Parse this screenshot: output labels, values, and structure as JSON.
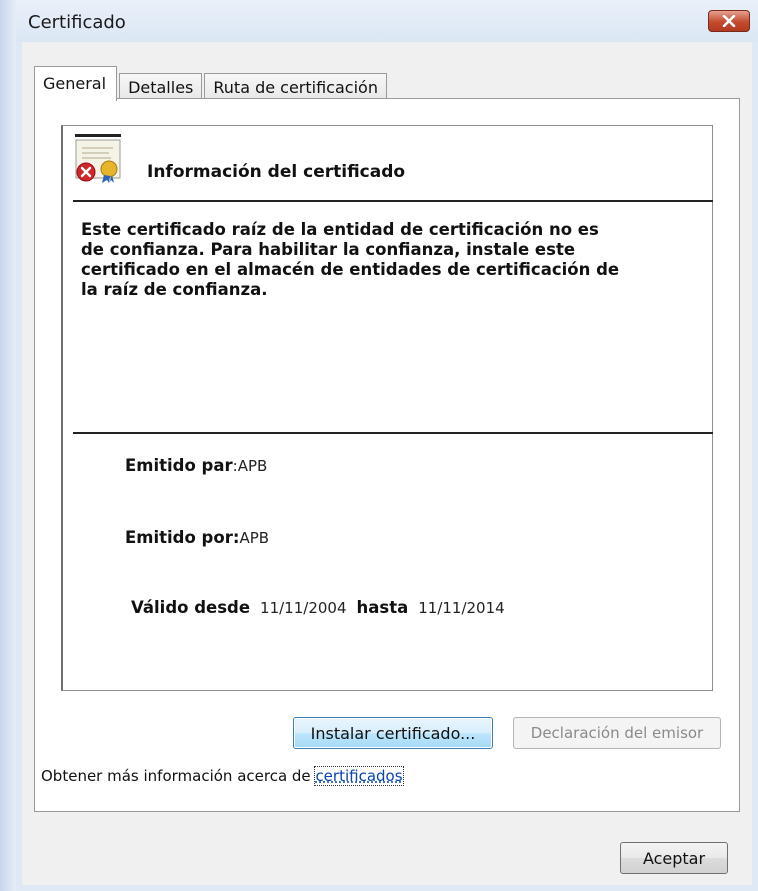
{
  "window": {
    "title": "Certificado"
  },
  "tabs": [
    {
      "label": "General",
      "active": true
    },
    {
      "label": "Detalles",
      "active": false
    },
    {
      "label": "Ruta de certificación",
      "active": false
    }
  ],
  "certificate": {
    "icon": "certificate-error-icon",
    "heading": "Información del certificado",
    "warning": "Este certificado raíz de la entidad de certificación no es de confianza. Para habilitar la confianza, instale este certificado en el almacén de entidades de certificación de la raíz de confianza.",
    "issued_to_label": "Emitido par",
    "issued_to_sep": ":",
    "issued_to_value": "APB",
    "issued_by_label": "Emitido por:",
    "issued_by_value": "APB",
    "valid_from_label": "Válido desde",
    "valid_from_value": "11/11/2004",
    "valid_to_label": "hasta",
    "valid_to_value": "11/11/2014"
  },
  "buttons": {
    "install": "Instalar certificado...",
    "declaration": "Declaración del emisor",
    "accept": "Aceptar"
  },
  "more_info": {
    "text": "Obtener más información acerca de ",
    "link": "certificados"
  },
  "colors": {
    "close_button": "#c54b2f",
    "link": "#0645ad",
    "install_border": "#3b7fb8"
  }
}
